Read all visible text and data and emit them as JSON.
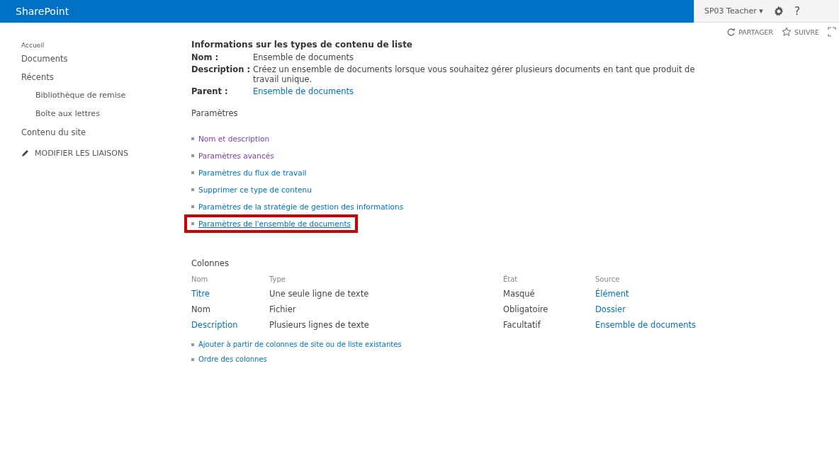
{
  "suite_bar": {
    "brand": "SharePoint",
    "user": "SP03 Teacher",
    "user_caret": "▾",
    "help": "?"
  },
  "actions": [
    {
      "label": "PARTAGER"
    },
    {
      "label": "SUIVRE"
    }
  ],
  "sidebar": {
    "items": [
      {
        "label": "Accueil"
      },
      {
        "label": "Documents"
      },
      {
        "label": "Récents",
        "children": [
          {
            "label": "Bibliothèque de remise"
          },
          {
            "label": "Boîte aux lettres"
          }
        ]
      },
      {
        "label": "Contenu du site"
      }
    ],
    "edit_links": "MODIFIER LES LIAISONS"
  },
  "info": {
    "title": "Informations sur les types de contenu de liste",
    "fields": [
      {
        "label": "Nom :",
        "value": "Ensemble de documents",
        "link": false
      },
      {
        "label": "Description :",
        "value": "Créez un ensemble de documents lorsque vous souhaitez gérer plusieurs documents en tant que produit de travail unique.",
        "link": false
      },
      {
        "label": "Parent :",
        "value": "Ensemble de documents",
        "link": true
      }
    ]
  },
  "settings": {
    "heading": "Paramètres",
    "links": [
      {
        "label": "Nom et description",
        "visited": true,
        "highlighted": false
      },
      {
        "label": "Paramètres avancés",
        "visited": true,
        "highlighted": false
      },
      {
        "label": "Paramètres du flux de travail",
        "visited": false,
        "highlighted": false
      },
      {
        "label": "Supprimer ce type de contenu",
        "visited": false,
        "highlighted": false
      },
      {
        "label": "Paramètres de la stratégie de gestion des informations",
        "visited": false,
        "highlighted": false
      },
      {
        "label": "Paramètres de l'ensemble de documents",
        "visited": false,
        "highlighted": true
      }
    ]
  },
  "columns": {
    "heading": "Colonnes",
    "table": {
      "columns": [
        "Nom",
        "Type",
        "État",
        "Source"
      ],
      "rows": [
        {
          "name": "Titre",
          "name_link": true,
          "type": "Une seule ligne de texte",
          "state": "Masqué",
          "source": "Élément"
        },
        {
          "name": "Nom",
          "name_link": false,
          "type": "Fichier",
          "state": "Obligatoire",
          "source": "Dossier"
        },
        {
          "name": "Description",
          "name_link": true,
          "type": "Plusieurs lignes de texte",
          "state": "Facultatif",
          "source": "Ensemble de documents"
        }
      ]
    },
    "links": [
      {
        "label": "Ajouter à partir de colonnes de site ou de liste existantes"
      },
      {
        "label": "Ordre des colonnes"
      }
    ]
  }
}
